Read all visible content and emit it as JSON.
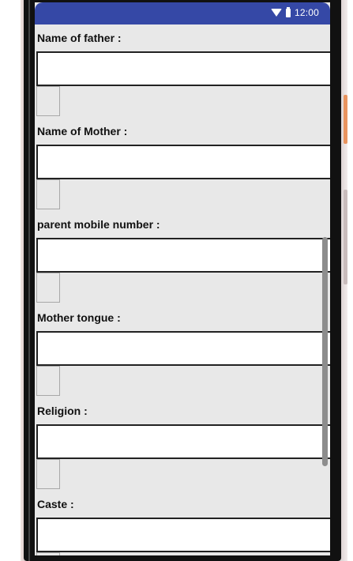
{
  "status_bar": {
    "time": "12:00",
    "wifi_icon": "wifi-icon",
    "battery_icon": "battery-icon",
    "color": "#3548a6"
  },
  "form": {
    "fields": [
      {
        "label": "Name of father :",
        "value": ""
      },
      {
        "label": "Name of Mother :",
        "value": ""
      },
      {
        "label": "parent mobile number :",
        "value": ""
      },
      {
        "label": "Mother tongue :",
        "value": ""
      },
      {
        "label": "Religion :",
        "value": ""
      },
      {
        "label": "Caste :",
        "value": ""
      }
    ]
  }
}
